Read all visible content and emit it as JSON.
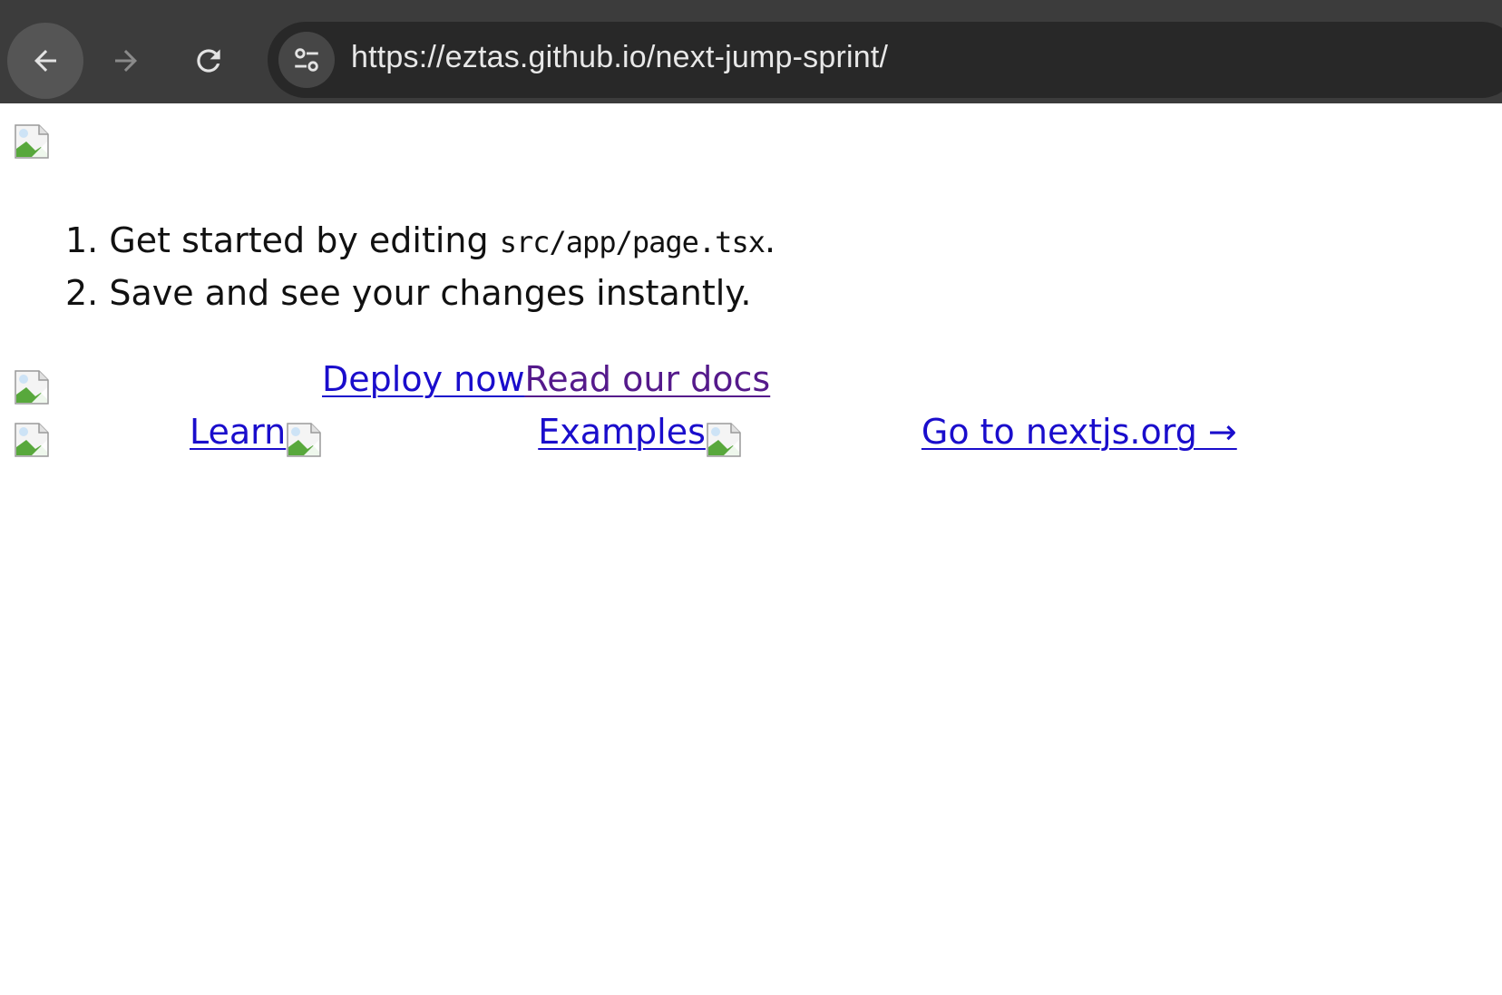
{
  "browser": {
    "url": "https://eztas.github.io/next-jump-sprint/",
    "back_icon": "arrow-left-icon",
    "forward_icon": "arrow-right-icon",
    "reload_icon": "reload-icon",
    "site_info_icon": "tune-icon"
  },
  "page": {
    "steps": [
      {
        "prefix": "1. Get started by editing ",
        "code": "src/app/page.tsx",
        "suffix": "."
      },
      {
        "text": "2. Save and see your changes instantly."
      }
    ],
    "cta": {
      "deploy": "Deploy now",
      "docs": "Read our docs"
    },
    "footer": {
      "learn": "Learn",
      "examples": "Examples",
      "nextjs": "Go to nextjs.org →"
    }
  },
  "colors": {
    "toolbar": "#3c3c3c",
    "omnibox": "#282828",
    "link": "#1a0dcc",
    "visited_link": "#551a8b"
  }
}
